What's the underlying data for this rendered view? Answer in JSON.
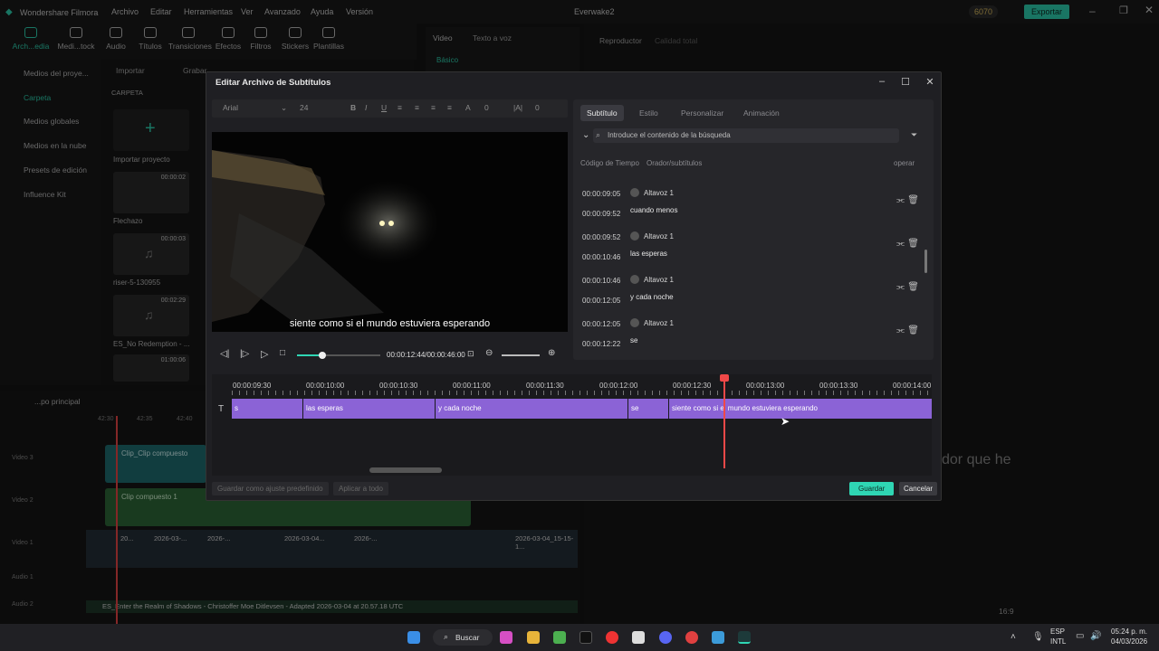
{
  "app": {
    "title": "Wondershare Filmora",
    "menu": [
      "Archivo",
      "Editar",
      "Herramientas",
      "Ver",
      "Avanzado",
      "Ayuda",
      "Versión"
    ],
    "project": "Everwake2",
    "credits": "6070",
    "export_label": "Exportar"
  },
  "toolbar": [
    "Arch...edia",
    "Medi...tock",
    "Audio",
    "Títulos",
    "Transiciones",
    "Efectos",
    "Filtros",
    "Stickers",
    "Plantillas"
  ],
  "left_panel": {
    "items": [
      "Medios del proye...",
      "Carpeta",
      "Medios globales",
      "Medios en la nube",
      "Presets de edición",
      "Influence Kit"
    ]
  },
  "media": {
    "import_label": "Importar",
    "record_label": "Grabar",
    "folder_label": "CARPETA",
    "import_project": "Importar proyecto",
    "items": [
      {
        "name": "Flechazo",
        "duration": "00:00:02"
      },
      {
        "name": "riser-5-130955",
        "duration": "00:00:03"
      },
      {
        "name": "ES_No Redemption - ...",
        "duration": "00:02:29"
      },
      {
        "name": "",
        "duration": "01:00:06"
      }
    ]
  },
  "behind_right": {
    "tabs": [
      "Video",
      "Texto a voz"
    ],
    "sub_tab": "Básico",
    "player_label": "Reproductor",
    "quality": "Calidad total",
    "caption": "dor que he",
    "ratio": "16:9"
  },
  "main_timeline": {
    "label": "...po principal",
    "tracks": [
      "Video 3",
      "Video 2",
      "Video 1",
      "Audio 1",
      "Audio 2"
    ],
    "clip3": "Clip_Clip compuesto",
    "clip2": "Clip compuesto 1",
    "clips1": [
      "20...",
      "2026-03-...",
      "2026-...",
      "2026-03-04...",
      "2026-...",
      "2026-03-04_15-15-1..."
    ],
    "audio_name": "ES_Enter the Realm of Shadows - Christoffer Moe Ditlevsen - Adapted 2026-03-04 at 20.57.18 UTC",
    "time_a": "42:30",
    "time_b": "42:35",
    "time_c": "42:40"
  },
  "dialog": {
    "title": "Editar Archivo de Subtítulos",
    "format": {
      "font": "Arial",
      "size": "24",
      "spacing": "0",
      "line": "0"
    },
    "preview_subtitle": "siente como si el mundo estuviera esperando",
    "player": {
      "time": "00:00:12:44/00:00:46:00"
    },
    "tabs": [
      "Subtítulo",
      "Estilo",
      "Personalizar",
      "Animación"
    ],
    "search_placeholder": "Introduce el contenido de la búsqueda",
    "columns": {
      "time": "Código de Tiempo",
      "speaker": "Orador/subtítulos",
      "action": "operar"
    },
    "rows": [
      {
        "start": "00:00:09:05",
        "end": "00:00:09:52",
        "speaker": "Altavoz 1",
        "text": "cuando menos"
      },
      {
        "start": "00:00:09:52",
        "end": "00:00:10:46",
        "speaker": "Altavoz 1",
        "text": "las esperas"
      },
      {
        "start": "00:00:10:46",
        "end": "00:00:12:05",
        "speaker": "Altavoz 1",
        "text": "y cada noche"
      },
      {
        "start": "00:00:12:05",
        "end": "00:00:12:22",
        "speaker": "Altavoz 1",
        "text": "se"
      }
    ],
    "ruler": [
      "00:00:09:30",
      "00:00:10:00",
      "00:00:10:30",
      "00:00:11:00",
      "00:00:11:30",
      "00:00:12:00",
      "00:00:12:30",
      "00:00:13:00",
      "00:00:13:30",
      "00:00:14:00"
    ],
    "clips": [
      "s",
      "las esperas",
      "y cada noche",
      "se",
      "siente como si el mundo estuviera esperando"
    ],
    "buttons": {
      "save_preset": "Guardar como ajuste predefinido",
      "apply_all": "Aplicar a todo",
      "save": "Guardar",
      "cancel": "Cancelar"
    }
  },
  "taskbar": {
    "search": "Buscar",
    "lang1": "ESP",
    "lang2": "INTL",
    "time": "05:24 p. m.",
    "date": "04/03/2026"
  },
  "colors": {
    "accent": "#2fd6b4",
    "clip": "#8b63d6",
    "playhead": "#f04848"
  }
}
